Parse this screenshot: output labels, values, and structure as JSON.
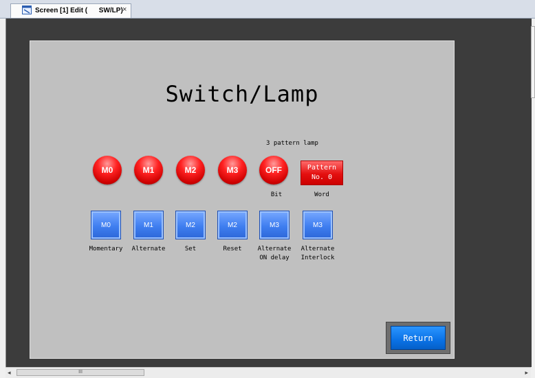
{
  "tab": {
    "title": "Screen [1] Edit (      SW/LP)",
    "close": "×"
  },
  "screen": {
    "title": "Switch/Lamp",
    "pattern_lamp_caption": "3 pattern lamp",
    "lamps": [
      "M0",
      "M1",
      "M2",
      "M3"
    ],
    "bit_lamp": {
      "label": "OFF",
      "caption": "Bit"
    },
    "word_lamp": {
      "line1": "Pattern",
      "line2": "No. 0",
      "caption": "Word"
    },
    "switches": [
      {
        "label": "M0",
        "caption": "Momentary"
      },
      {
        "label": "M1",
        "caption": "Alternate"
      },
      {
        "label": "M2",
        "caption": "Set"
      },
      {
        "label": "M2",
        "caption": "Reset"
      },
      {
        "label": "M3",
        "caption": "Alternate\nON delay"
      },
      {
        "label": "M3",
        "caption": "Alternate\nInterlock"
      }
    ],
    "return_button": "Return"
  },
  "scrollbar": {
    "left_arrow": "◂",
    "right_arrow": "▸",
    "grip": "III"
  }
}
